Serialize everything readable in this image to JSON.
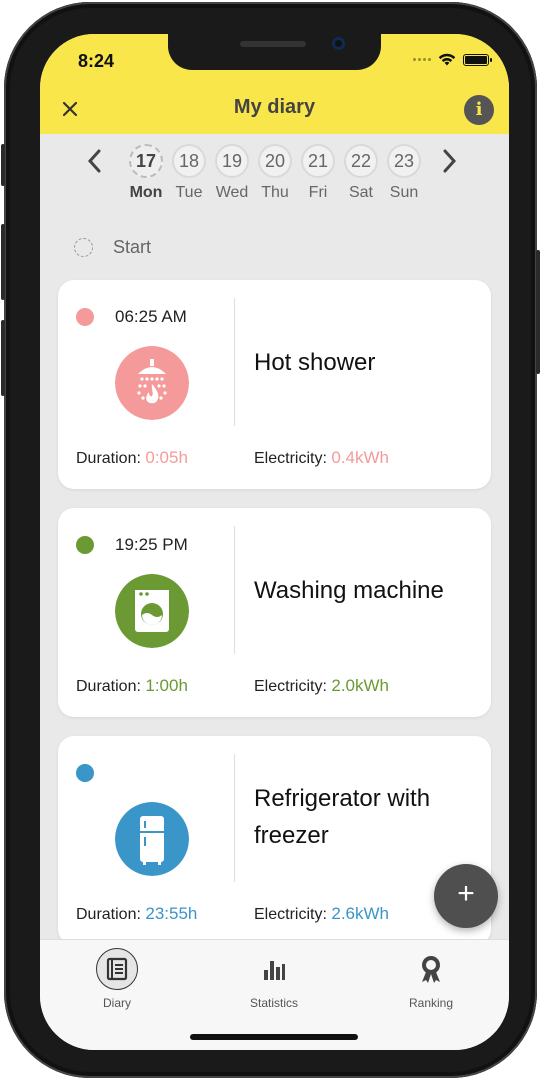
{
  "status_bar": {
    "time": "8:24"
  },
  "header": {
    "title": "My diary",
    "close_icon": "close-icon",
    "info_label": "i"
  },
  "week": {
    "days": [
      {
        "num": "17",
        "name": "Mon",
        "selected": true
      },
      {
        "num": "18",
        "name": "Tue"
      },
      {
        "num": "19",
        "name": "Wed"
      },
      {
        "num": "20",
        "name": "Thu"
      },
      {
        "num": "21",
        "name": "Fri"
      },
      {
        "num": "22",
        "name": "Sat"
      },
      {
        "num": "23",
        "name": "Sun"
      }
    ]
  },
  "start": {
    "label": "Start"
  },
  "entries": [
    {
      "time": "06:25 AM",
      "name": "Hot shower",
      "duration_label": "Duration:",
      "duration_value": "0:05h",
      "electricity_label": "Electricity:",
      "electricity_value": "0.4kWh",
      "color": "#f59a9a",
      "icon": "shower-icon"
    },
    {
      "time": "19:25 PM",
      "name": "Washing machine",
      "duration_label": "Duration:",
      "duration_value": "1:00h",
      "electricity_label": "Electricity:",
      "electricity_value": "2.0kWh",
      "color": "#6b9a34",
      "icon": "washing-machine-icon"
    },
    {
      "time": "",
      "name": "Refrigerator with freezer",
      "duration_label": "Duration:",
      "duration_value": "23:55h",
      "electricity_label": "Electricity:",
      "electricity_value": "2.6kWh",
      "color": "#3a95c8",
      "icon": "refrigerator-icon"
    }
  ],
  "fab": {
    "label": "+"
  },
  "nav": [
    {
      "label": "Diary",
      "icon": "diary-icon",
      "active": true
    },
    {
      "label": "Statistics",
      "icon": "statistics-icon"
    },
    {
      "label": "Ranking",
      "icon": "ranking-icon"
    }
  ],
  "colors": {
    "header_bg": "#f9e64a",
    "screen_bg": "#e9e9e9"
  }
}
